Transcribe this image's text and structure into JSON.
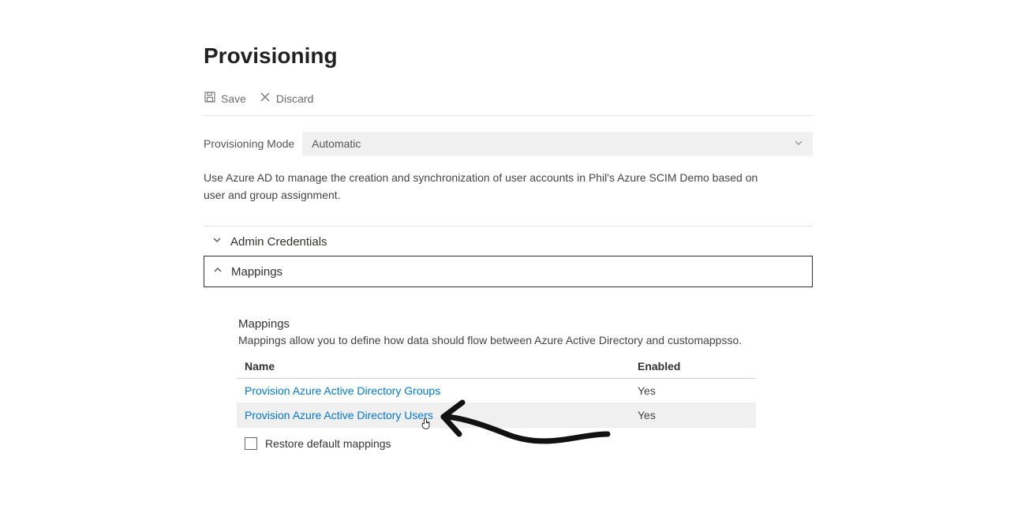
{
  "header": {
    "title": "Provisioning"
  },
  "toolbar": {
    "save_label": "Save",
    "discard_label": "Discard"
  },
  "mode": {
    "label": "Provisioning Mode",
    "value": "Automatic"
  },
  "description": "Use Azure AD to manage the creation and synchronization of user accounts in Phil's Azure SCIM Demo based on user and group assignment.",
  "sections": {
    "admin_credentials": {
      "title": "Admin Credentials"
    },
    "mappings": {
      "title": "Mappings",
      "heading": "Mappings",
      "description": "Mappings allow you to define how data should flow between Azure Active Directory and customappsso.",
      "columns": {
        "name": "Name",
        "enabled": "Enabled"
      },
      "rows": [
        {
          "name": "Provision Azure Active Directory Groups",
          "enabled": "Yes"
        },
        {
          "name": "Provision Azure Active Directory Users",
          "enabled": "Yes"
        }
      ],
      "restore_label": "Restore default mappings"
    }
  }
}
